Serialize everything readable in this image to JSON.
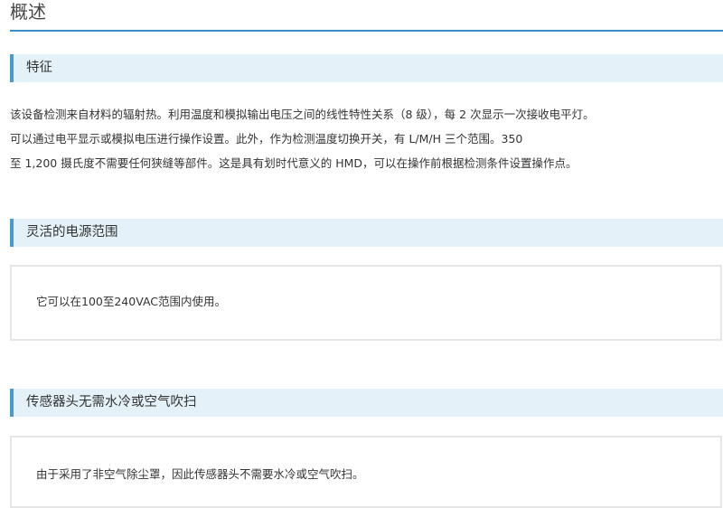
{
  "page": {
    "title": "概述"
  },
  "sections": [
    {
      "heading": "特征",
      "lines": [
        "该设备检测来自材料的辐射热。利用温度和模拟输出电压之间的线性特性关系（8 级），每 2 次显示一次接收电平灯。",
        "可以通过电平显示或模拟电压进行操作设置。此外，作为检测温度切换开关，有 L/M/H 三个范围。350",
        "至 1,200 摄氏度不需要任何狭缝等部件。这是具有划时代意义的 HMD，可以在操作前根据检测条件设置操作点。"
      ]
    },
    {
      "heading": "灵活的电源范围",
      "text": "它可以在100至240VAC范围内使用。"
    },
    {
      "heading": "传感器头无需水冷或空气吹扫",
      "text": "由于采用了非空气除尘罩，因此传感器头不需要水冷或空气吹扫。"
    }
  ],
  "colors": {
    "accent": "#3a8fc9",
    "heading_bg": "#e4f1f8",
    "box_border": "#e6e6e6"
  }
}
